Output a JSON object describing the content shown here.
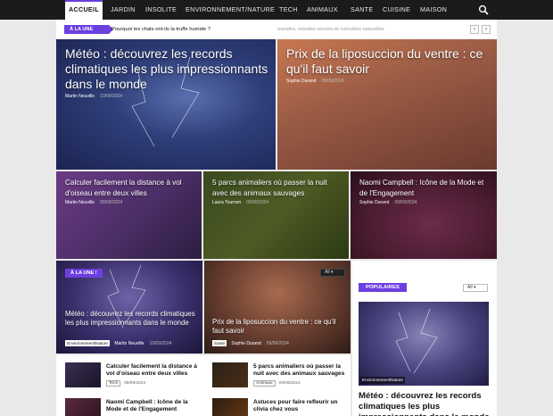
{
  "nav": {
    "items": [
      "ACCUEIL",
      "JARDIN",
      "INSOLITE",
      "ENVIRONNEMENT/NATURE",
      "TECH",
      "ANIMAUX",
      "SANTE",
      "CUISINE",
      "MAISON"
    ],
    "active": "ACCUEIL"
  },
  "ticker": {
    "badge": "À LA UNE",
    "text": "Pourquoi les chats ont-ils la truffe humide ?",
    "ghost": "mondes, mondes secrets et curiosités naturelles"
  },
  "hero": [
    {
      "title": "Météo : découvrez les records climatiques les plus impressionnants dans le monde",
      "author": "Martin Neuville",
      "date": "10/09/2024"
    },
    {
      "title": "Prix de la liposuccion du ventre : ce qu'il faut savoir",
      "author": "Sophie Durand",
      "date": "09/09/2024"
    },
    {
      "title": "Calculer facilement la distance à vol d'oiseau entre deux villes",
      "author": "Martin Neuville",
      "date": "09/09/2024"
    },
    {
      "title": "5 parcs animaliers où passer la nuit avec des animaux sauvages",
      "author": "Laura Tournon",
      "date": "09/09/2024"
    },
    {
      "title": "Naomi Campbell : Icône de la Mode et de l'Engagement",
      "author": "Sophie Durand",
      "date": "09/09/2024"
    }
  ],
  "boxes": {
    "b1": {
      "badge": "À LA UNE !",
      "title": "Météo : découvrez les records climatiques les plus impressionnants dans le monde",
      "category": "Environnement/Nature",
      "author": "Martin Neuville",
      "date": "10/09/2024"
    },
    "b2": {
      "select": "All",
      "title": "Prix de la liposuccion du ventre : ce qu'il faut savoir",
      "category": "Santé",
      "author": "Sophie Durand",
      "date": "09/09/2024"
    }
  },
  "list": [
    {
      "title": "Calculer facilement la distance à vol d'oiseau entre deux villes",
      "category": "Tech",
      "date": "09/09/2024"
    },
    {
      "title": "5 parcs animaliers où passer la nuit avec des animaux sauvages",
      "category": "Animaux",
      "date": "09/09/2024"
    },
    {
      "title": "Naomi Campbell : Icône de la Mode et de l'Engagement",
      "category": "",
      "date": ""
    },
    {
      "title": "Astuces pour faire refleurir un clivia chez vous",
      "category": "",
      "date": ""
    }
  ],
  "popular": {
    "badge": "POPULAIRES",
    "select": "All",
    "image_category": "Environnement/Nature",
    "title": "Météo : découvrez les records climatiques les plus impressionnants dans le monde"
  },
  "colors": {
    "accent": "#6b3fe0",
    "nav_bg": "#1b1b1b"
  }
}
